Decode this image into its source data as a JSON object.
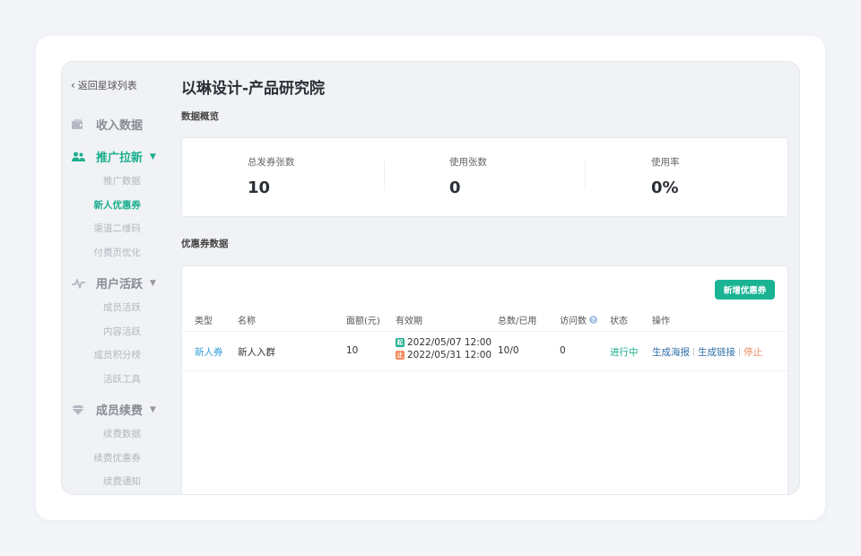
{
  "sidebar": {
    "back_label": "返回星球列表",
    "sections": [
      {
        "label": "收入数据",
        "icon": "wallet-icon",
        "active": false,
        "expandable": false
      },
      {
        "label": "推广拉新",
        "icon": "users-icon",
        "active": true,
        "expandable": true,
        "items": [
          {
            "label": "推广数据",
            "active": false
          },
          {
            "label": "新人优惠券",
            "active": true
          },
          {
            "label": "渠道二维码",
            "active": false
          },
          {
            "label": "付费页优化",
            "active": false
          }
        ]
      },
      {
        "label": "用户活跃",
        "icon": "pulse-icon",
        "active": false,
        "expandable": true,
        "items": [
          {
            "label": "成员活跃"
          },
          {
            "label": "内容活跃"
          },
          {
            "label": "成员积分榜"
          },
          {
            "label": "活跃工具"
          }
        ]
      },
      {
        "label": "成员续费",
        "icon": "diamond-icon",
        "active": false,
        "expandable": true,
        "items": [
          {
            "label": "续费数据"
          },
          {
            "label": "续费优惠券"
          },
          {
            "label": "续费通知"
          }
        ]
      }
    ]
  },
  "main": {
    "title": "以琳设计-产品研究院",
    "overview_label": "数据概览",
    "stats": [
      {
        "label": "总发券张数",
        "value": "10"
      },
      {
        "label": "使用张数",
        "value": "0"
      },
      {
        "label": "使用率",
        "value": "0%"
      }
    ],
    "coupon_label": "优惠券数据",
    "add_button": "新增优惠券",
    "table": {
      "headers": [
        "类型",
        "名称",
        "面额(元)",
        "有效期",
        "总数/已用",
        "访问数",
        "状态",
        "操作"
      ],
      "rows": [
        {
          "type": "新人券",
          "name": "新人入群",
          "amount": "10",
          "start": "2022/05/07 12:00",
          "end": "2022/05/31 12:00",
          "total_used": "10/0",
          "visits": "0",
          "status": "进行中",
          "actions": [
            "生成海报",
            "生成链接",
            "停止"
          ]
        }
      ]
    }
  },
  "colors": {
    "accent": "#1aae8c",
    "link": "#2f6fa8",
    "warn": "#f08a5d",
    "type_link": "#2f9ed9"
  }
}
